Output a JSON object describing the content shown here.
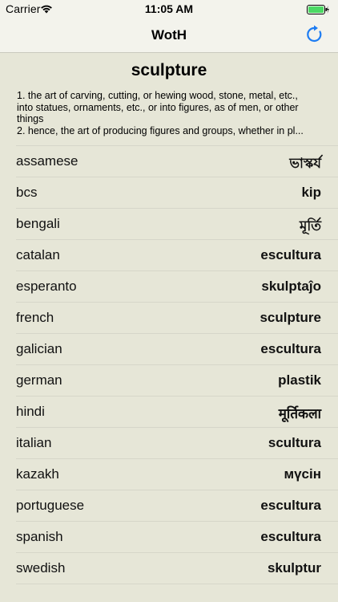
{
  "status_bar": {
    "carrier": "Carrier",
    "time": "11:05 AM",
    "battery_color": "#4cd964"
  },
  "nav": {
    "title": "WotH",
    "refresh_icon": "refresh-icon",
    "accent_color": "#1d7cf2"
  },
  "entry": {
    "headword": "sculpture",
    "definition_lines": [
      "1. the art of carving, cutting, or hewing wood, stone, metal, etc.,",
      "into statues, ornaments, etc., or into figures, as of men, or other",
      "things",
      "2. hence, the art of producing figures and groups, whether in pl..."
    ]
  },
  "translations": [
    {
      "lang": "assamese",
      "word": "ভাস্কৰ্য"
    },
    {
      "lang": "bcs",
      "word": "kip"
    },
    {
      "lang": "bengali",
      "word": "মূর্তি"
    },
    {
      "lang": "catalan",
      "word": "escultura"
    },
    {
      "lang": "esperanto",
      "word": "skulptaĵo"
    },
    {
      "lang": "french",
      "word": "sculpture"
    },
    {
      "lang": "galician",
      "word": "escultura"
    },
    {
      "lang": "german",
      "word": "plastik"
    },
    {
      "lang": "hindi",
      "word": "मूर्तिकला"
    },
    {
      "lang": "italian",
      "word": "scultura"
    },
    {
      "lang": "kazakh",
      "word": "мүсін"
    },
    {
      "lang": "portuguese",
      "word": "escultura"
    },
    {
      "lang": "spanish",
      "word": "escultura"
    },
    {
      "lang": "swedish",
      "word": "skulptur"
    }
  ]
}
